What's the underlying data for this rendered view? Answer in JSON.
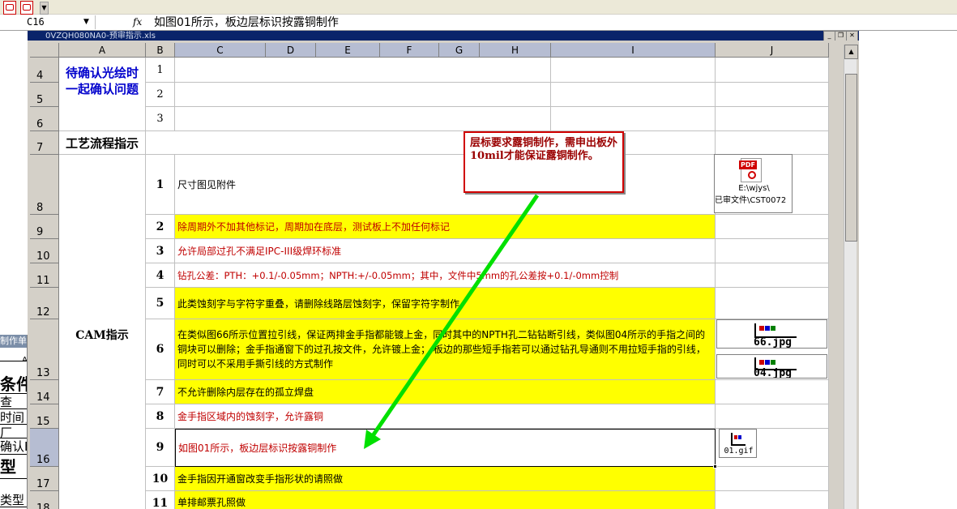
{
  "toolbar": {
    "icons": [
      "pdf-icon",
      "pdf-edit-icon"
    ]
  },
  "formula_bar": {
    "cell_ref": "C16",
    "fx_label": "fx",
    "content": "如图01所示，板边层标识按露铜制作"
  },
  "workbook": {
    "title": "0VZQH080NA0-预审指示.xls"
  },
  "column_headers": [
    "A",
    "B",
    "C",
    "D",
    "E",
    "F",
    "G",
    "H",
    "I",
    "J"
  ],
  "row_numbers": [
    "4",
    "5",
    "6",
    "7",
    "8",
    "9",
    "10",
    "11",
    "12",
    "13",
    "14",
    "15",
    "16",
    "17",
    "18"
  ],
  "sections": {
    "pending_title": "待确认光绘时一起确认问题",
    "process_title": "工艺流程指示",
    "cam_title": "CAM指示"
  },
  "pending_rows": [
    "1",
    "2",
    "3"
  ],
  "cam_items": [
    {
      "num": "1",
      "text": "尺寸图见附件",
      "style": "plain"
    },
    {
      "num": "2",
      "text": "除周期外不加其他标记，周期加在底层，测试板上不加任何标记",
      "style": "yellow-red"
    },
    {
      "num": "3",
      "text": "允许局部过孔不满足IPC-III级焊环标准",
      "style": "white-red"
    },
    {
      "num": "4",
      "text": "钻孔公差：PTH：+0.1/-0.05mm；NPTH:+/-0.05mm；其中，文件中5mm的孔公差按+0.1/-0mm控制",
      "style": "white-red"
    },
    {
      "num": "5",
      "text": "此类蚀刻字与字符字重叠，请删除线路层蚀刻字，保留字符字制作",
      "style": "yellow"
    },
    {
      "num": "6",
      "text": "在类似图66所示位置拉引线，保证两排金手指都能镀上金，同时其中的NPTH孔二钻钻断引线，类似图04所示的手指之间的铜块可以删除；金手指通窗下的过孔按文件，允许镀上金；  板边的那些短手指若可以通过钻孔导通则不用拉短手指的引线，同时可以不采用手撕引线的方式制作",
      "style": "yellow"
    },
    {
      "num": "7",
      "text": "不允许删除内层存在的孤立焊盘",
      "style": "yellow"
    },
    {
      "num": "8",
      "text": "金手指区域内的蚀刻字，允许露铜",
      "style": "white-red"
    },
    {
      "num": "9",
      "text": "如图01所示，板边层标识按露铜制作",
      "style": "white-red"
    },
    {
      "num": "10",
      "text": "金手指因开通窗改变手指形状的请照做",
      "style": "yellow"
    },
    {
      "num": "11",
      "text": "单排邮票孔照做",
      "style": "yellow"
    }
  ],
  "attachments": {
    "pdf_label": "PDF",
    "pdf_path": "E:\\wjys\\",
    "pdf_file": "已审文件\\CST0072",
    "img66": "66.jpg",
    "img04": "04.jpg",
    "img01": "01.gif"
  },
  "callout": {
    "text": "层标要求露铜制作，需申出板外10mil才能保证露铜制作。"
  },
  "background_window": {
    "title": "制作单",
    "lines": [
      "条件",
      "查",
      "时间",
      "厂",
      "确认E",
      "型",
      "类型"
    ]
  },
  "colors": {
    "highlight": "#ffff00",
    "text_red": "#c00000",
    "arrow": "#00e000",
    "callout_border": "#d00000"
  }
}
